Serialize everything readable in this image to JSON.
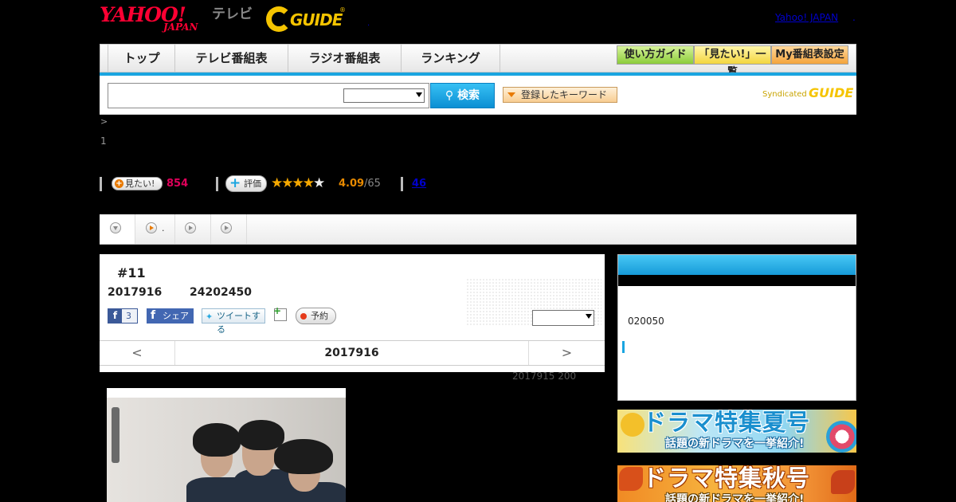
{
  "header": {
    "yahoo_logo": "YAHOO!",
    "yahoo_sub": "JAPAN",
    "tv_label": "テレビ",
    "gguide_logo": "GUIDE",
    "gguide_reg": "®",
    "dot": ".",
    "yj_link": "Yahoo! JAPAN",
    "yj_link_suffix": "."
  },
  "nav": {
    "tabs": [
      {
        "label": "トップ"
      },
      {
        "label": "テレビ番組表"
      },
      {
        "label": "ラジオ番組表"
      },
      {
        "label": "ランキング"
      }
    ],
    "guide_buttons": [
      {
        "label": "使い方ガイド"
      },
      {
        "label": "「見たい!」一覧"
      },
      {
        "label": "My番組表設定"
      }
    ],
    "accent_color": "#1aa5e0"
  },
  "search": {
    "input_value": "",
    "select_value": "",
    "button_label": "検索",
    "keyword_button": "登録したキーワード",
    "syndicated_label": "Syndicated",
    "syndicated_logo": "GUIDE"
  },
  "breadcrumb": ">",
  "page_index": "1",
  "stats": {
    "mitai_label": "見たい!",
    "mitai_count": "854",
    "hyoka_label": "評価",
    "stars_on": "★★★★",
    "stars_off": "★",
    "score": "4.09",
    "score_den": "/65",
    "reviews": "46",
    "rating_value": 4.09,
    "rating_max": 5
  },
  "tabstrip": {
    "tab2_label": "."
  },
  "program": {
    "episode": "#11",
    "date": "2017916",
    "time": "24202450",
    "fb_like_count": "3",
    "fb_share_label": "シェア",
    "tweet_label": "ツイートする",
    "reserve_label": "予約",
    "select_value": "",
    "prev_label": "<",
    "current_date": "2017916",
    "next_label": ">",
    "updated": "2017915  200"
  },
  "sidebar": {
    "box_text": "020050",
    "banner_summer_title": "ドラマ特集夏号",
    "banner_summer_sub": "話題の新ドラマを一挙紹介!",
    "banner_autumn_title": "ドラマ特集秋号",
    "banner_autumn_sub": "話題の新ドラマを一挙紹介!"
  }
}
